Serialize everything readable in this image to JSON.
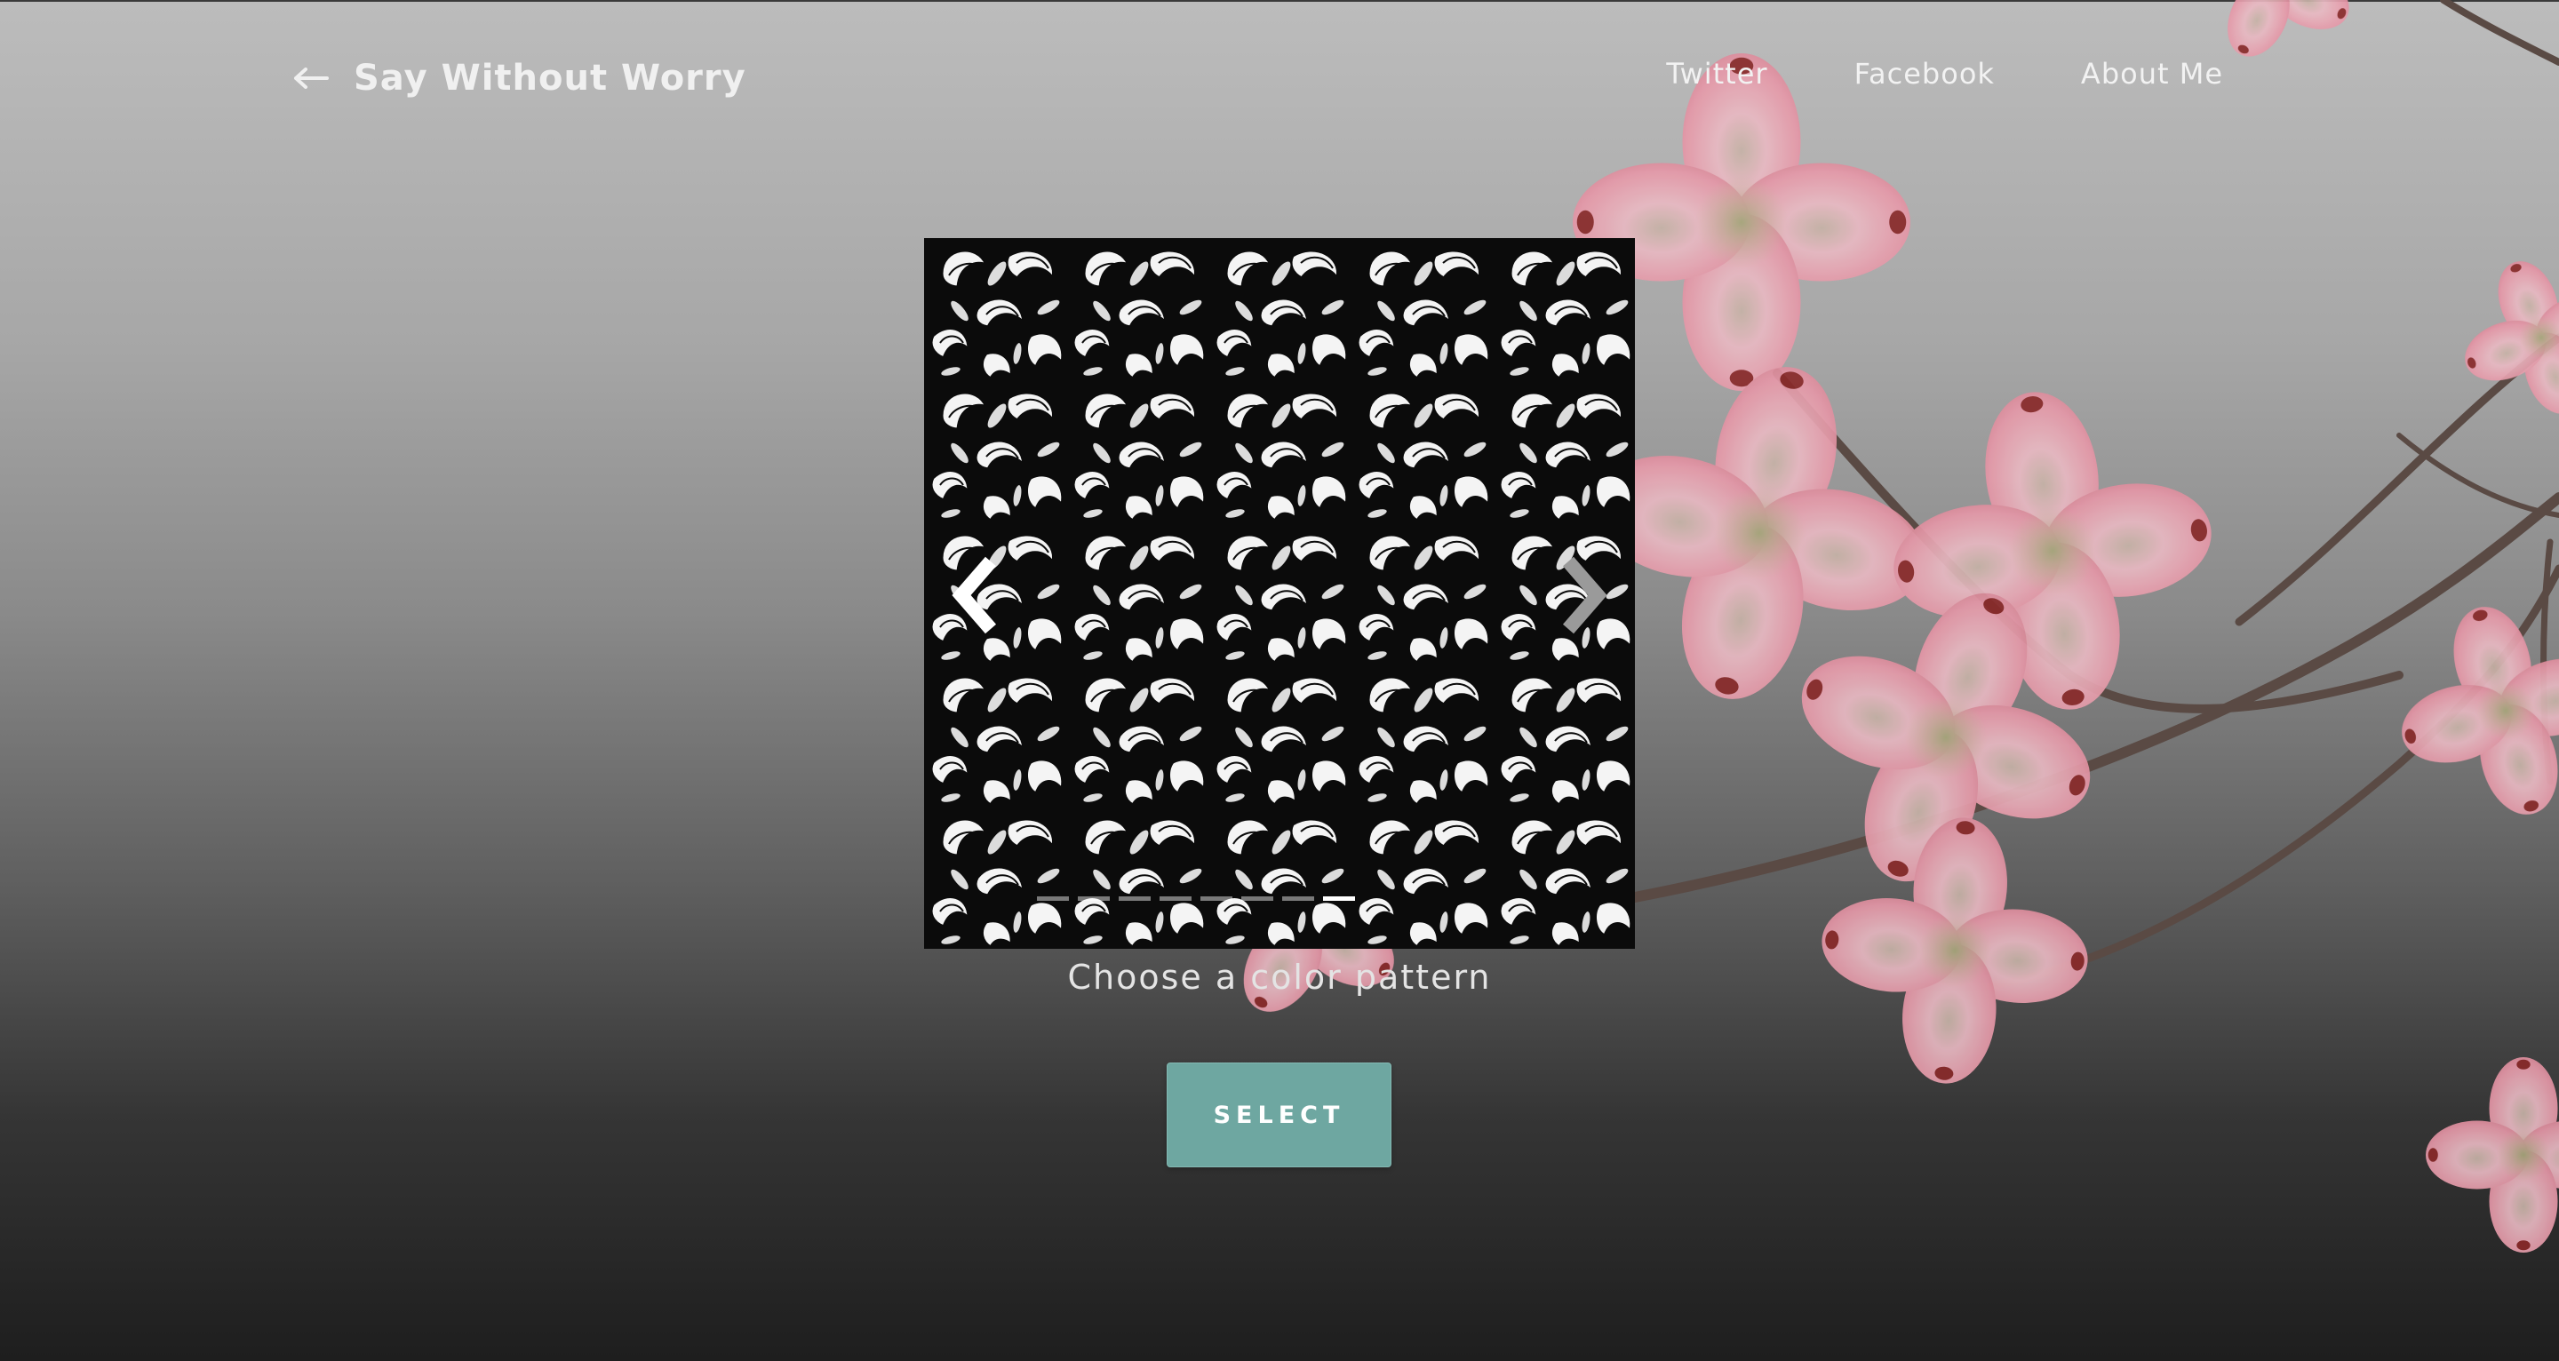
{
  "header": {
    "title": "Say Without Worry",
    "back_icon": "back-arrow-icon"
  },
  "nav": {
    "items": [
      {
        "label": "Twitter"
      },
      {
        "label": "Facebook"
      },
      {
        "label": "About Me"
      }
    ]
  },
  "carousel": {
    "slide_count": 8,
    "active_slide": 7,
    "prev_icon": "chevron-left-icon",
    "next_icon": "chevron-right-icon",
    "caption": "Choose a color pattern"
  },
  "actions": {
    "select_label": "SELECT"
  },
  "colors": {
    "accent": "#6ea7a1",
    "blossom": "#e8a8b4"
  }
}
